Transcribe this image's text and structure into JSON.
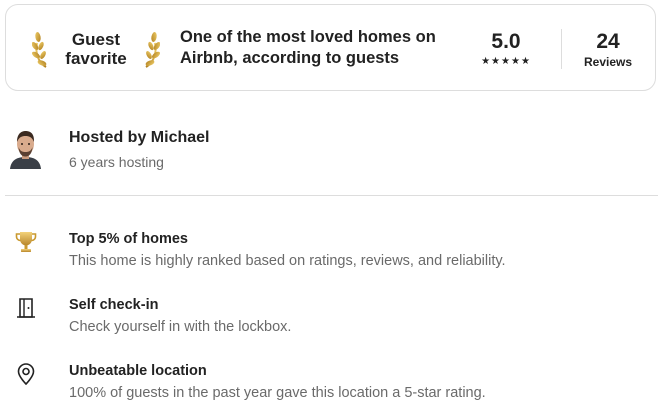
{
  "guest_favorite": {
    "badge_line1": "Guest",
    "badge_line2": "favorite",
    "description": "One of the most loved homes on Airbnb, according to guests",
    "rating": "5.0",
    "stars": "★★★★★",
    "reviews_count": "24",
    "reviews_label": "Reviews"
  },
  "host": {
    "name": "Hosted by Michael",
    "years": "6 years hosting"
  },
  "highlights": [
    {
      "icon": "trophy-icon",
      "title": "Top 5% of homes",
      "subtitle": "This home is highly ranked based on ratings, reviews, and reliability."
    },
    {
      "icon": "door-icon",
      "title": "Self check-in",
      "subtitle": "Check yourself in with the lockbox."
    },
    {
      "icon": "location-pin-icon",
      "title": "Unbeatable location",
      "subtitle": "100% of guests in the past year gave this location a 5-star rating."
    }
  ],
  "colors": {
    "text_primary": "#222222",
    "text_secondary": "#6a6a6a",
    "border": "#dddddd",
    "laurel_gold": "#c79a2e"
  }
}
